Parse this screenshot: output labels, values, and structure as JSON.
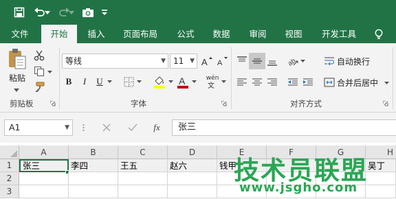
{
  "quick_access": {
    "icons": [
      "save-icon",
      "undo-icon",
      "redo-icon",
      "camera-icon",
      "customize-qat-icon"
    ]
  },
  "tabs": [
    {
      "label": "文件",
      "active": false
    },
    {
      "label": "开始",
      "active": true
    },
    {
      "label": "插入",
      "active": false
    },
    {
      "label": "页面布局",
      "active": false
    },
    {
      "label": "公式",
      "active": false
    },
    {
      "label": "数据",
      "active": false
    },
    {
      "label": "审阅",
      "active": false
    },
    {
      "label": "视图",
      "active": false
    },
    {
      "label": "开发工具",
      "active": false
    }
  ],
  "tell_me_icon": "lightbulb-icon",
  "ribbon": {
    "clipboard": {
      "paste_label": "粘贴",
      "group_label": "剪贴板"
    },
    "font": {
      "name": "等线",
      "size": "11",
      "group_label": "字体",
      "bold": "B",
      "italic": "I",
      "underline": "U",
      "phonetic": "wén",
      "font_color": "#c00000",
      "fill_color": "#ffff00"
    },
    "alignment": {
      "wrap_text": "自动换行",
      "merge_center": "合并后居中",
      "group_label": "对齐方式"
    }
  },
  "formula_bar": {
    "name_box": "A1",
    "content": "张三",
    "fx": "fx"
  },
  "columns": [
    "A",
    "B",
    "C",
    "D",
    "E",
    "F",
    "G",
    "H"
  ],
  "rows": [
    "1",
    "2",
    "3"
  ],
  "row1_cells": [
    "张三",
    "李四",
    "王五",
    "赵六",
    "钱甲",
    "",
    "",
    "吴丁"
  ],
  "watermark": {
    "main": "技术员联盟",
    "url": "www.jsgho.com"
  },
  "colors": {
    "brand": "#217346",
    "watermark": "#2aa654"
  }
}
